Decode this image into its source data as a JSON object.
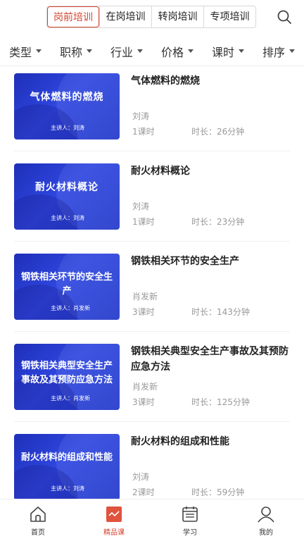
{
  "header": {
    "tabs": [
      {
        "label": "岗前培训",
        "active": true
      },
      {
        "label": "在岗培训",
        "active": false
      },
      {
        "label": "转岗培训",
        "active": false
      },
      {
        "label": "专项培训",
        "active": false
      }
    ],
    "search_icon": "search-icon"
  },
  "filters": [
    {
      "label": "类型"
    },
    {
      "label": "职称"
    },
    {
      "label": "行业"
    },
    {
      "label": "价格"
    },
    {
      "label": "课时"
    },
    {
      "label": "排序"
    }
  ],
  "courses": [
    {
      "thumb_title": "气体燃料的燃烧",
      "thumb_lecturer": "主讲人：刘涛",
      "title": "气体燃料的燃烧",
      "teacher": "刘涛",
      "lessons": "1课时",
      "duration": "时长：26分钟"
    },
    {
      "thumb_title": "耐火材料概论",
      "thumb_lecturer": "主讲人：刘涛",
      "title": "耐火材料概论",
      "teacher": "刘涛",
      "lessons": "1课时",
      "duration": "时长：23分钟"
    },
    {
      "thumb_title": "钢铁相关环节的安全生产",
      "thumb_lecturer": "主讲人：肖发新",
      "title": "钢铁相关环节的安全生产",
      "teacher": "肖发新",
      "lessons": "3课时",
      "duration": "时长：143分钟"
    },
    {
      "thumb_title": "钢铁相关典型安全生产事故及其预防应急方法",
      "thumb_lecturer": "主讲人：肖发新",
      "title": "钢铁相关典型安全生产事故及其预防应急方法",
      "teacher": "肖发新",
      "lessons": "3课时",
      "duration": "时长：125分钟"
    },
    {
      "thumb_title": "耐火材料的组成和性能",
      "thumb_lecturer": "主讲人：刘涛",
      "title": "耐火材料的组成和性能",
      "teacher": "刘涛",
      "lessons": "2课时",
      "duration": "时长：59分钟"
    }
  ],
  "bottom_nav": [
    {
      "label": "首页",
      "icon": "home-icon",
      "active": false
    },
    {
      "label": "精品课",
      "icon": "course-icon",
      "active": true
    },
    {
      "label": "学习",
      "icon": "schedule-icon",
      "active": false
    },
    {
      "label": "我的",
      "icon": "user-icon",
      "active": false
    }
  ],
  "colors": {
    "accent": "#d4442f",
    "thumb_blue": "#2f47e0"
  }
}
